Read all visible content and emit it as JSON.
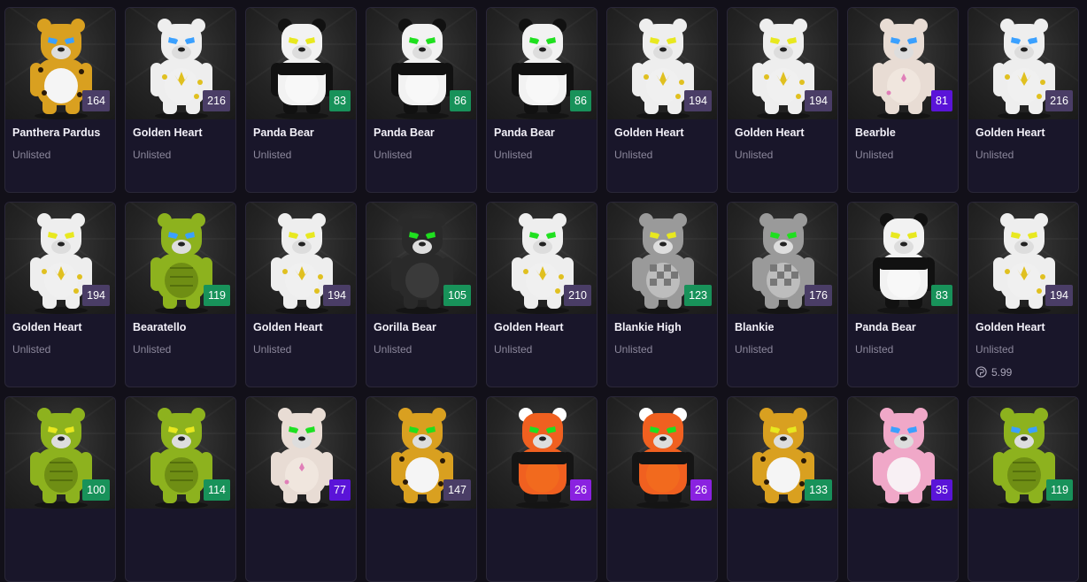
{
  "items": [
    {
      "name": "Panthera Pardus",
      "status": "Unlisted",
      "rank": "164",
      "rank_color": "#4a3d66",
      "pattern": "leopard",
      "fur": "#d9a020",
      "eyes": "#3aa0ff"
    },
    {
      "name": "Golden Heart",
      "status": "Unlisted",
      "rank": "216",
      "rank_color": "#4a3d66",
      "pattern": "golden",
      "fur": "#eeeeee",
      "eyes": "#3aa0ff"
    },
    {
      "name": "Panda Bear",
      "status": "Unlisted",
      "rank": "83",
      "rank_color": "#18925a",
      "pattern": "panda",
      "fur": "#f2f2f2",
      "eyes": "#e8e820"
    },
    {
      "name": "Panda Bear",
      "status": "Unlisted",
      "rank": "86",
      "rank_color": "#18925a",
      "pattern": "panda",
      "fur": "#f2f2f2",
      "eyes": "#20e020"
    },
    {
      "name": "Panda Bear",
      "status": "Unlisted",
      "rank": "86",
      "rank_color": "#18925a",
      "pattern": "panda",
      "fur": "#f2f2f2",
      "eyes": "#20e020"
    },
    {
      "name": "Golden Heart",
      "status": "Unlisted",
      "rank": "194",
      "rank_color": "#4a3d66",
      "pattern": "golden",
      "fur": "#eeeeee",
      "eyes": "#e8e820"
    },
    {
      "name": "Golden Heart",
      "status": "Unlisted",
      "rank": "194",
      "rank_color": "#4a3d66",
      "pattern": "golden",
      "fur": "#eeeeee",
      "eyes": "#e8e820"
    },
    {
      "name": "Bearble",
      "status": "Unlisted",
      "rank": "81",
      "rank_color": "#5a14d8",
      "pattern": "bearble",
      "fur": "#e8dcd4",
      "eyes": "#3aa0ff"
    },
    {
      "name": "Golden Heart",
      "status": "Unlisted",
      "rank": "216",
      "rank_color": "#4a3d66",
      "pattern": "golden",
      "fur": "#eeeeee",
      "eyes": "#3aa0ff"
    },
    {
      "name": "Golden Heart",
      "status": "Unlisted",
      "rank": "194",
      "rank_color": "#4a3d66",
      "pattern": "golden",
      "fur": "#eeeeee",
      "eyes": "#e8e820"
    },
    {
      "name": "Bearatello",
      "status": "Unlisted",
      "rank": "119",
      "rank_color": "#18925a",
      "pattern": "turtle",
      "fur": "#8db21e",
      "eyes": "#3aa0ff"
    },
    {
      "name": "Golden Heart",
      "status": "Unlisted",
      "rank": "194",
      "rank_color": "#4a3d66",
      "pattern": "golden",
      "fur": "#eeeeee",
      "eyes": "#e8e820"
    },
    {
      "name": "Gorilla Bear",
      "status": "Unlisted",
      "rank": "105",
      "rank_color": "#18925a",
      "pattern": "gorilla",
      "fur": "#2a2a2a",
      "eyes": "#20e020"
    },
    {
      "name": "Golden Heart",
      "status": "Unlisted",
      "rank": "210",
      "rank_color": "#4a3d66",
      "pattern": "golden",
      "fur": "#eeeeee",
      "eyes": "#20e020"
    },
    {
      "name": "Blankie High",
      "status": "Unlisted",
      "rank": "123",
      "rank_color": "#18925a",
      "pattern": "checker",
      "fur": "#9a9a9a",
      "eyes": "#e8e820"
    },
    {
      "name": "Blankie",
      "status": "Unlisted",
      "rank": "176",
      "rank_color": "#4a3d66",
      "pattern": "checker",
      "fur": "#9a9a9a",
      "eyes": "#20e020"
    },
    {
      "name": "Panda Bear",
      "status": "Unlisted",
      "rank": "83",
      "rank_color": "#18925a",
      "pattern": "panda",
      "fur": "#f2f2f2",
      "eyes": "#e8e820"
    },
    {
      "name": "Golden Heart",
      "status": "Unlisted",
      "rank": "194",
      "rank_color": "#4a3d66",
      "pattern": "golden",
      "fur": "#eeeeee",
      "eyes": "#e8e820",
      "price": "5.99"
    },
    {
      "name": "",
      "status": "",
      "rank": "100",
      "rank_color": "#18925a",
      "pattern": "turtle",
      "fur": "#8db21e",
      "eyes": "#e8e820"
    },
    {
      "name": "",
      "status": "",
      "rank": "114",
      "rank_color": "#18925a",
      "pattern": "turtle",
      "fur": "#8db21e",
      "eyes": "#e8e820"
    },
    {
      "name": "",
      "status": "",
      "rank": "77",
      "rank_color": "#5a14d8",
      "pattern": "bearble",
      "fur": "#e8dcd4",
      "eyes": "#20e020"
    },
    {
      "name": "",
      "status": "",
      "rank": "147",
      "rank_color": "#4a3d66",
      "pattern": "leopard",
      "fur": "#d9a020",
      "eyes": "#20e020"
    },
    {
      "name": "",
      "status": "",
      "rank": "26",
      "rank_color": "#8a22e0",
      "pattern": "redpanda",
      "fur": "#f06020",
      "eyes": "#20e020"
    },
    {
      "name": "",
      "status": "",
      "rank": "26",
      "rank_color": "#8a22e0",
      "pattern": "redpanda",
      "fur": "#f06020",
      "eyes": "#20e020"
    },
    {
      "name": "",
      "status": "",
      "rank": "133",
      "rank_color": "#18925a",
      "pattern": "leopard",
      "fur": "#d9a020",
      "eyes": "#e8e820"
    },
    {
      "name": "",
      "status": "",
      "rank": "35",
      "rank_color": "#5a14d8",
      "pattern": "pink",
      "fur": "#f0a8c8",
      "eyes": "#3aa0ff"
    },
    {
      "name": "",
      "status": "",
      "rank": "119",
      "rank_color": "#18925a",
      "pattern": "turtle",
      "fur": "#8db21e",
      "eyes": "#3aa0ff"
    }
  ]
}
